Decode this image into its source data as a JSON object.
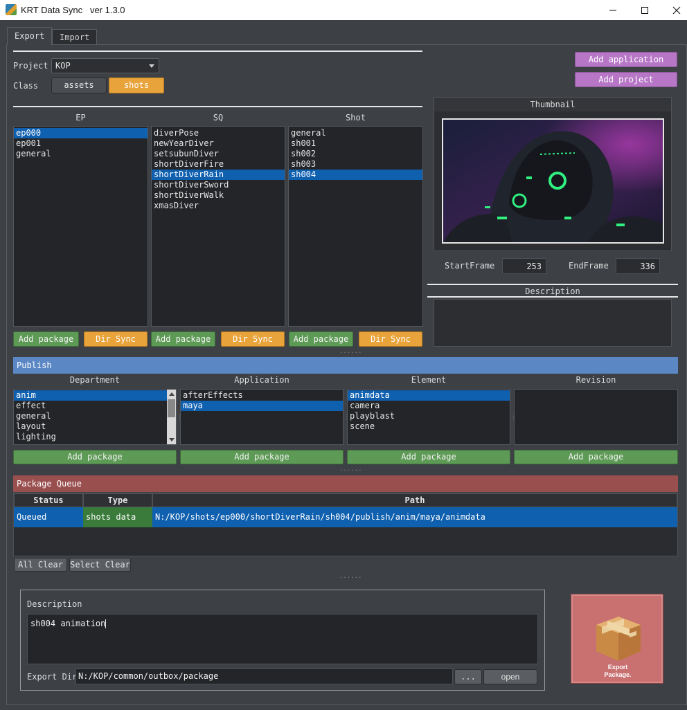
{
  "window": {
    "title": "KRT Data Sync   ver 1.3.0",
    "icon": "app-logo-icon"
  },
  "tabs": [
    {
      "label": "Export",
      "active": true
    },
    {
      "label": "Import",
      "active": false
    }
  ],
  "top": {
    "project_label": "Project",
    "project_value": "KOP",
    "class_label": "Class",
    "class_options": [
      "assets",
      "shots"
    ],
    "class_selected": "shots",
    "add_application_label": "Add application",
    "add_project_label": "Add project"
  },
  "browser": {
    "columns": [
      {
        "header": "EP",
        "items": [
          "ep000",
          "ep001",
          "general"
        ],
        "selected": "ep000"
      },
      {
        "header": "SQ",
        "items": [
          "diverPose",
          "newYearDiver",
          "setsubunDiver",
          "shortDiverFire",
          "shortDiverRain",
          "shortDiverSword",
          "shortDiverWalk",
          "xmasDiver"
        ],
        "selected": "shortDiverRain"
      },
      {
        "header": "Shot",
        "items": [
          "general",
          "sh001",
          "sh002",
          "sh003",
          "sh004"
        ],
        "selected": "sh004"
      }
    ],
    "add_package_label": "Add package",
    "dir_sync_label": "Dir Sync"
  },
  "thumbnail": {
    "header": "Thumbnail",
    "start_label": "StartFrame",
    "start_value": "253",
    "end_label": "EndFrame",
    "end_value": "336",
    "description_header": "Description"
  },
  "publish": {
    "title": "Publish",
    "bar_color": "#5b87c5",
    "columns": [
      {
        "header": "Department",
        "items": [
          "anim",
          "effect",
          "general",
          "layout",
          "lighting"
        ],
        "selected": "anim"
      },
      {
        "header": "Application",
        "items": [
          "afterEffects",
          "maya"
        ],
        "selected": "maya"
      },
      {
        "header": "Element",
        "items": [
          "animdata",
          "camera",
          "playblast",
          "scene"
        ],
        "selected": "animdata"
      },
      {
        "header": "Revision",
        "items": [],
        "selected": ""
      }
    ],
    "add_package_label": "Add package"
  },
  "queue": {
    "title": "Package Queue",
    "bar_color": "#9a4f4f",
    "headers": {
      "status": "Status",
      "type": "Type",
      "path": "Path"
    },
    "rows": [
      {
        "status": "Queued",
        "type": "shots data",
        "path": "N:/KOP/shots/ep000/shortDiverRain/sh004/publish/anim/maya/animdata"
      }
    ],
    "all_clear_label": "All Clear",
    "select_clear_label": "Select Clear"
  },
  "export": {
    "description_label": "Description",
    "description_value": "sh004 animation",
    "export_dir_label": "Export Dir",
    "export_dir_value": "N:/KOP/common/outbox/package",
    "browse_label": "...",
    "open_label": "open",
    "export_button_label_line1": "Export",
    "export_button_label_line2": "Package.",
    "export_button_color": "#c97070"
  },
  "colors": {
    "selection": "#1060b0",
    "orange": "#e8a33a",
    "green": "#5d9a55",
    "purple": "#b777c6",
    "type_cell": "#3a7a3a"
  }
}
